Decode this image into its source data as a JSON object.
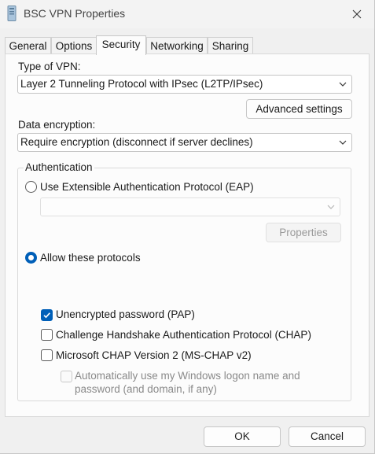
{
  "window": {
    "title": "BSC VPN Properties"
  },
  "tabs": [
    "General",
    "Options",
    "Security",
    "Networking",
    "Sharing"
  ],
  "security": {
    "vpn_type_label": "Type of VPN:",
    "vpn_type_value": "Layer 2 Tunneling Protocol with IPsec (L2TP/IPsec)",
    "advanced_label": "Advanced settings",
    "encryption_label": "Data encryption:",
    "encryption_value": "Require encryption (disconnect if server declines)",
    "auth": {
      "title": "Authentication",
      "eap_label": "Use Extensible Authentication Protocol (EAP)",
      "eap_value": "",
      "properties_label": "Properties",
      "allow_label": "Allow these protocols",
      "pap_label": "Unencrypted password (PAP)",
      "chap_label": "Challenge Handshake Authentication Protocol (CHAP)",
      "mschap_label": "Microsoft CHAP Version 2 (MS-CHAP v2)",
      "autologon_line1": "Automatically use my Windows logon name and",
      "autologon_line2": "password (and domain, if any)"
    }
  },
  "footer": {
    "ok_label": "OK",
    "cancel_label": "Cancel"
  },
  "state": {
    "active_tab": "Security",
    "selected_auth": "Allow these protocols",
    "pap_checked": true,
    "chap_checked": false,
    "mschap_checked": false,
    "autologon_checked": false
  },
  "colors": {
    "accent": "#005fb8",
    "window_bg": "#f0f0f0",
    "panel_bg": "#fcfcfc"
  }
}
